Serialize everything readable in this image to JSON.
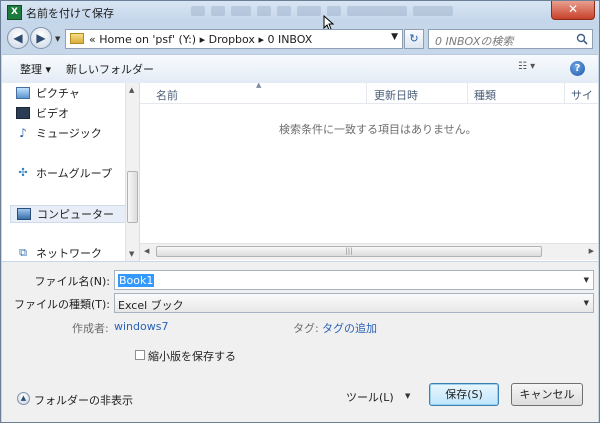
{
  "window": {
    "title": "名前を付けて保存",
    "close_label": "✕"
  },
  "address": {
    "path": "«  Home on 'psf' (Y:)  ▸  Dropbox  ▸  0   INBOX",
    "search_placeholder": "0  INBOXの検索"
  },
  "toolbar": {
    "organize": "整理 ▾",
    "new_folder": "新しいフォルダー",
    "view": "☷ ▾",
    "help": "?"
  },
  "nav_pane": {
    "items": [
      {
        "label": "ピクチャ",
        "icon": "pictures-icon"
      },
      {
        "label": "ビデオ",
        "icon": "video-icon"
      },
      {
        "label": "ミュージック",
        "icon": "music-icon"
      },
      {
        "label": "ホームグループ",
        "icon": "homegroup-icon"
      },
      {
        "label": "コンピューター",
        "icon": "computer-icon"
      },
      {
        "label": "ネットワーク",
        "icon": "network-icon"
      }
    ]
  },
  "file_list": {
    "columns": [
      "名前",
      "更新日時",
      "種類",
      "サイ"
    ],
    "empty_message": "検索条件に一致する項目はありません。"
  },
  "form": {
    "filename_label": "ファイル名(N):",
    "filename_value": "Book1",
    "filetype_label": "ファイルの種類(T):",
    "filetype_value": "Excel ブック",
    "author_label": "作成者:",
    "author_value": "windows7",
    "tags_label": "タグ:",
    "tags_value": "タグの追加",
    "thumbnail_label": "縮小版を保存する"
  },
  "footer": {
    "hide_folders": "フォルダーの非表示",
    "tools": "ツール(L)",
    "save": "保存(S)",
    "cancel": "キャンセル"
  },
  "colors": {
    "title_bg": "#c7d7ea",
    "link": "#2a62b5",
    "selection": "#3399ff",
    "close": "#c7402a"
  }
}
